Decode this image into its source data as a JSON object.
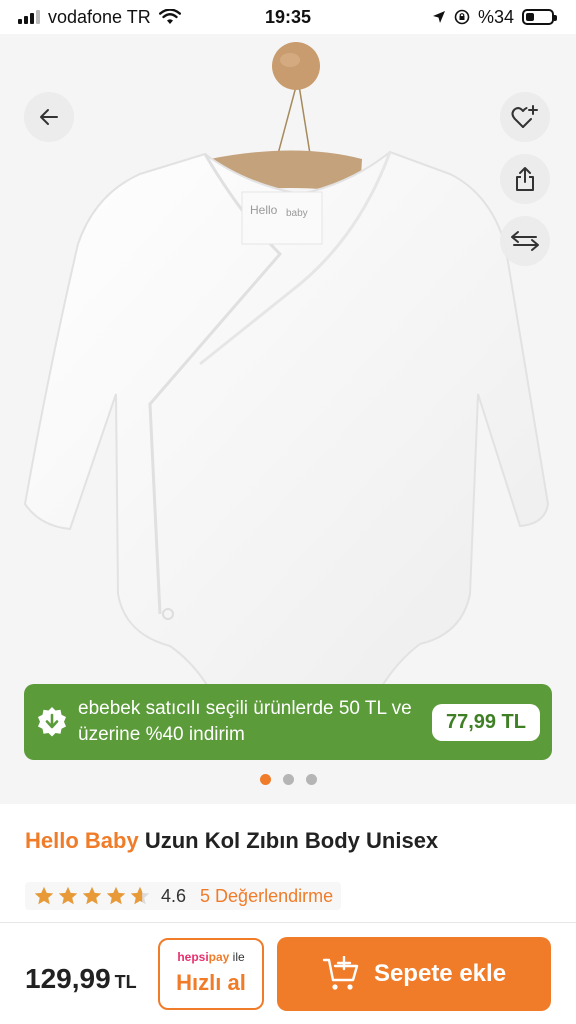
{
  "status_bar": {
    "carrier": "vodafone TR",
    "time": "19:35",
    "battery_percent": "%34",
    "battery_level": 0.34
  },
  "product": {
    "brand": "Hello Baby",
    "name": "Uzun Kol Zıbın Body Unisex",
    "image_count": 3,
    "active_image_index": 0
  },
  "gallery_buttons": {
    "back_icon": "arrow-left-icon",
    "favorite_icon": "heart-plus-icon",
    "share_icon": "share-icon",
    "compare_icon": "compare-arrows-icon"
  },
  "promo": {
    "text": "ebebek satıcılı seçili ürünlerde 50 TL ve üzerine %40 indirim",
    "price": "77,99 TL",
    "icon": "discount-badge-icon"
  },
  "rating": {
    "value": "4.6",
    "stars": 4.6,
    "reviews_label": "5 Değerlendirme"
  },
  "purchase": {
    "price": "129,99",
    "currency": "TL",
    "quick_buy_brand_a": "hepsi",
    "quick_buy_brand_b": "pay",
    "quick_buy_suffix": " ile",
    "quick_buy_label": "Hızlı al",
    "add_to_cart_label": "Sepete ekle"
  },
  "colors": {
    "accent": "#f07c2a",
    "promo_green": "#5b9b3a"
  }
}
